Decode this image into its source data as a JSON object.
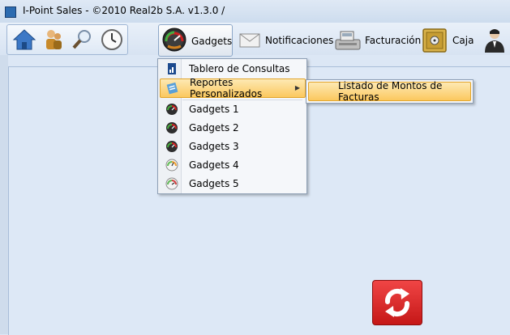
{
  "window": {
    "title": "I-Point Sales  - ©2010 Real2b S.A. v1.3.0 /"
  },
  "toolbar": {
    "gadgets_label": "Gadgets",
    "notificaciones_label": "Notificaciones",
    "facturacion_label": "Facturación",
    "caja_label": "Caja"
  },
  "menu": {
    "items": [
      {
        "label": "Tablero de Consultas",
        "icon": "dashboard-doc-icon"
      },
      {
        "label": "Reportes Personalizados",
        "icon": "report-icon",
        "has_submenu": true,
        "selected": true
      },
      {
        "label": "Gadgets 1",
        "icon": "gauge-red-icon"
      },
      {
        "label": "Gadgets 2",
        "icon": "gauge-red-icon"
      },
      {
        "label": "Gadgets 3",
        "icon": "gauge-red-icon"
      },
      {
        "label": "Gadgets 4",
        "icon": "gauge-white-icon"
      },
      {
        "label": "Gadgets 5",
        "icon": "gauge-white-icon"
      }
    ],
    "submenu": {
      "label": "Listado de Montos de Facturas"
    }
  },
  "colors": {
    "accent_selected": "#fbc85e",
    "refresh_button": "#d62020",
    "background": "#dde8f6"
  }
}
